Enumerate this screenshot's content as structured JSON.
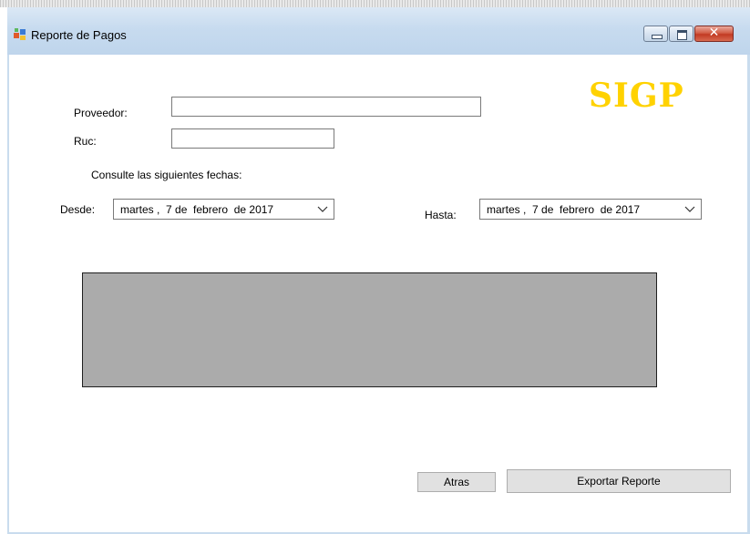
{
  "window": {
    "title": "Reporte de Pagos",
    "close_symbol": "✕"
  },
  "form": {
    "logo_text": "SIGP",
    "proveedor_label": "Proveedor:",
    "proveedor_value": "",
    "ruc_label": "Ruc:",
    "ruc_value": "",
    "instructions": "Consulte las siguientes fechas:",
    "desde_label": "Desde:",
    "desde_value": "martes ,  7 de  febrero  de 2017",
    "hasta_label": "Hasta:",
    "hasta_value": "martes ,  7 de  febrero  de 2017"
  },
  "buttons": {
    "atras_label": "Atras",
    "exportar_label": "Exportar Reporte"
  },
  "colors": {
    "logo": "#ffd200",
    "grid_background": "#ababab",
    "window_frame": "#c9dcee",
    "close_button": "#c23a23"
  },
  "icons": {
    "app": "form-window-icon",
    "dropdown": "chevron-down-icon"
  }
}
